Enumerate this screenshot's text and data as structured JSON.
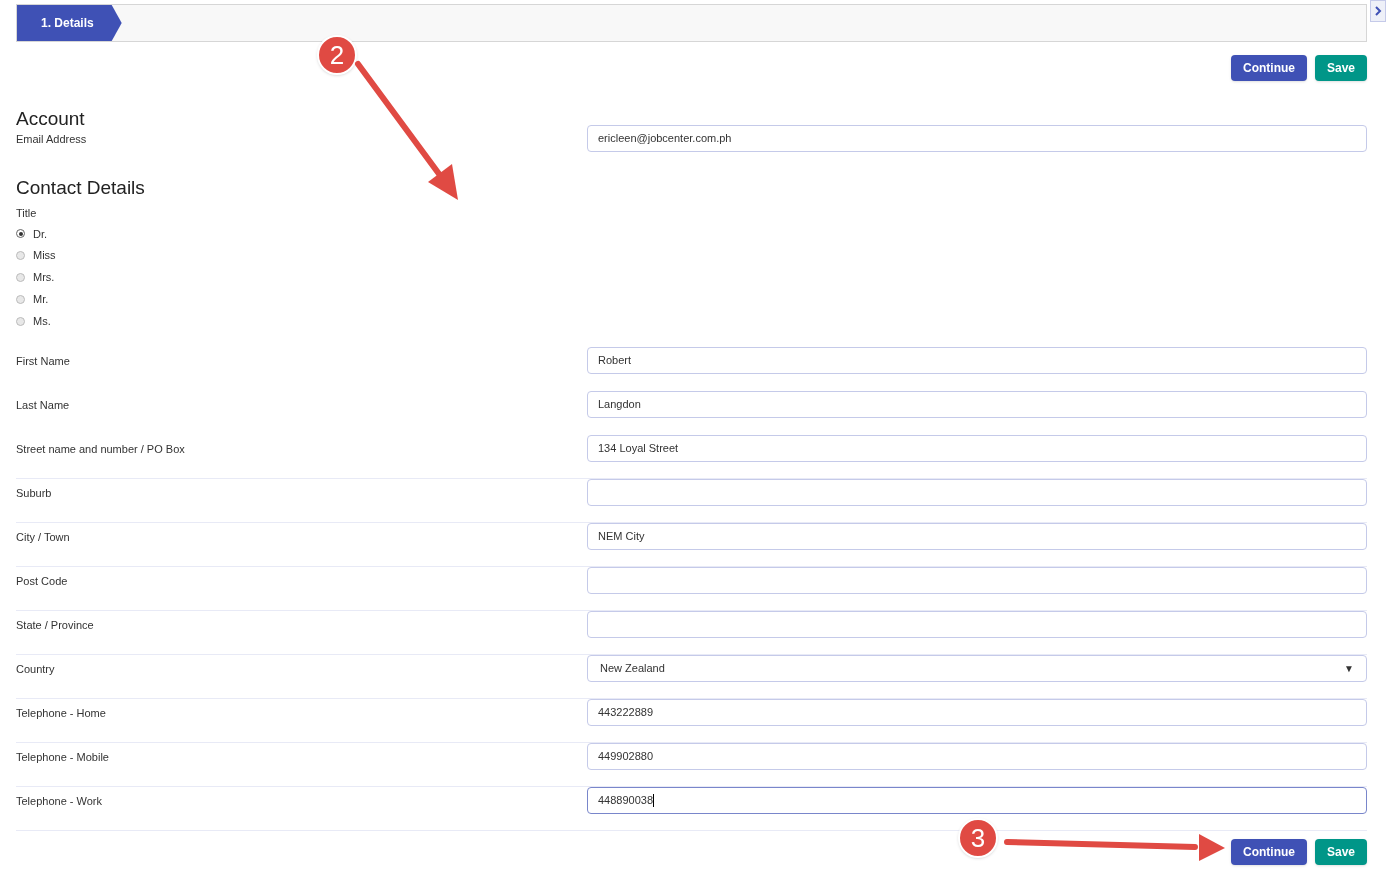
{
  "stepper": {
    "steps": [
      {
        "label": "1. Details",
        "selected": true
      }
    ]
  },
  "top_actions": [
    "Continue",
    "Save"
  ],
  "account": {
    "heading": "Account",
    "email": {
      "label": "Email Address",
      "value": "ericleen@jobcenter.com.ph"
    }
  },
  "contact": {
    "heading": "Contact Details",
    "title_label": "Title",
    "titles": [
      {
        "label": "Dr.",
        "selected": true
      },
      {
        "label": "Miss",
        "selected": false
      },
      {
        "label": "Mrs.",
        "selected": false
      },
      {
        "label": "Mr.",
        "selected": false
      },
      {
        "label": "Ms.",
        "selected": false
      }
    ],
    "fields": [
      {
        "kind": "text",
        "label": "First Name",
        "value": "Robert",
        "focused": false
      },
      {
        "kind": "text",
        "label": "Last Name",
        "value": "Langdon",
        "focused": false
      },
      {
        "kind": "text",
        "label": "Street name and number / PO Box",
        "value": "134 Loyal Street",
        "focused": false
      },
      {
        "kind": "text",
        "label": "Suburb",
        "focused": false
      },
      {
        "kind": "text",
        "label": "City / Town",
        "value": "NEM City",
        "focused": false
      },
      {
        "kind": "text",
        "label": "Post Code",
        "focused": false
      },
      {
        "kind": "text",
        "label": "State / Province",
        "focused": false
      },
      {
        "kind": "select",
        "label": "Country",
        "value": "New Zealand",
        "caret": "▼",
        "focused": false
      },
      {
        "kind": "text",
        "label": "Telephone - Home",
        "value": "443222889",
        "focused": false
      },
      {
        "kind": "text",
        "label": "Telephone - Mobile",
        "value": "449902880",
        "focused": false
      },
      {
        "kind": "text",
        "label": "Telephone - Work",
        "value": "448890038",
        "focused": true
      }
    ]
  },
  "bottom_actions": [
    "Continue",
    "Save"
  ],
  "callouts": [
    "2",
    "3"
  ]
}
